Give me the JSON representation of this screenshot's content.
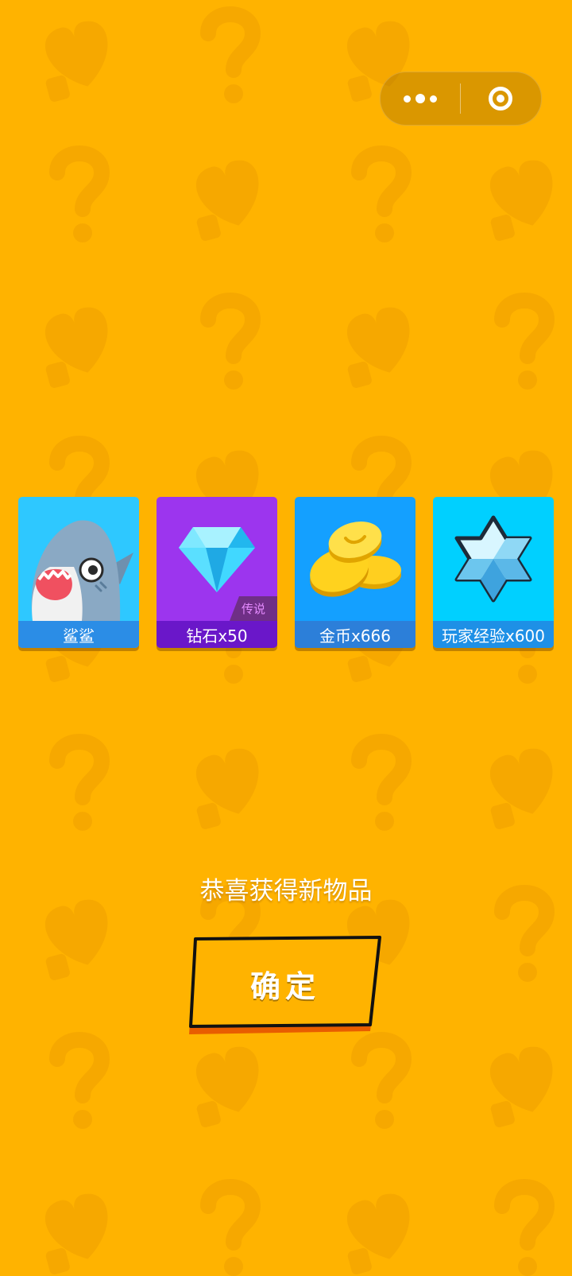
{
  "menu": {
    "more_icon": "more-dots-icon",
    "close_icon": "target-close-icon"
  },
  "rewards": [
    {
      "name": "鲨鲨",
      "icon": "shark-icon",
      "bg": "#2EC8FF",
      "label_bg": "#2B8DE6"
    },
    {
      "name": "钻石x50",
      "icon": "diamond-icon",
      "bg": "#9C35EE",
      "label_bg": "#6A17C9",
      "rarity": "传说"
    },
    {
      "name": "金币x666",
      "icon": "gold-coins-icon",
      "bg": "#14A0FF",
      "label_bg": "#2C7FD9"
    },
    {
      "name": "玩家经验x600",
      "icon": "xp-star-icon",
      "bg": "#00D0FF",
      "label_bg": "#1E90E6"
    }
  ],
  "message": "恭喜获得新物品",
  "confirm_label": "确定",
  "colors": {
    "background": "#FFB300",
    "button": "#FFB300",
    "button_border": "#111111"
  }
}
